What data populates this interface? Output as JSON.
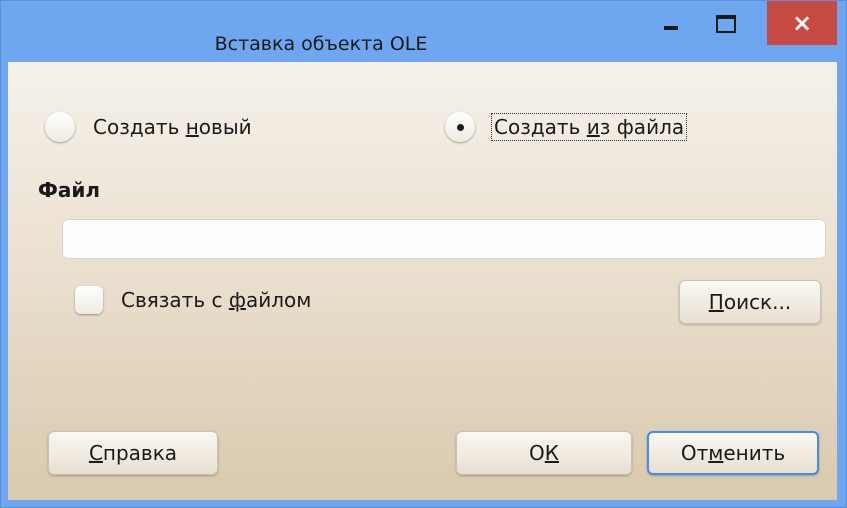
{
  "window": {
    "title": "Вставка объекта OLE",
    "close_glyph": "×"
  },
  "options": {
    "create_new": {
      "before": "Создать ",
      "mnemonic": "н",
      "after": "овый",
      "selected": false
    },
    "create_from_file": {
      "before": "Создать ",
      "mnemonic": "и",
      "after": "з файла",
      "selected": true
    }
  },
  "file": {
    "heading": "Файл",
    "path_value": "",
    "link_label": {
      "before": "Связать с ",
      "mnemonic": "ф",
      "after": "айлом"
    },
    "link_checked": false,
    "search_button": {
      "before": "",
      "mnemonic": "П",
      "after": "оиск..."
    }
  },
  "buttons": {
    "help": {
      "before": "",
      "mnemonic": "С",
      "after": "правка"
    },
    "ok": {
      "before": "О",
      "mnemonic": "К",
      "after": ""
    },
    "cancel": {
      "before": "От",
      "mnemonic": "м",
      "after": "енить"
    }
  },
  "colors": {
    "titlebar": "#6fa6f0",
    "close_button": "#c74a43",
    "default_button_border": "#3f8fe6"
  },
  "icons": {
    "minimize": "minimize-icon",
    "maximize": "maximize-icon",
    "close": "close-icon"
  }
}
